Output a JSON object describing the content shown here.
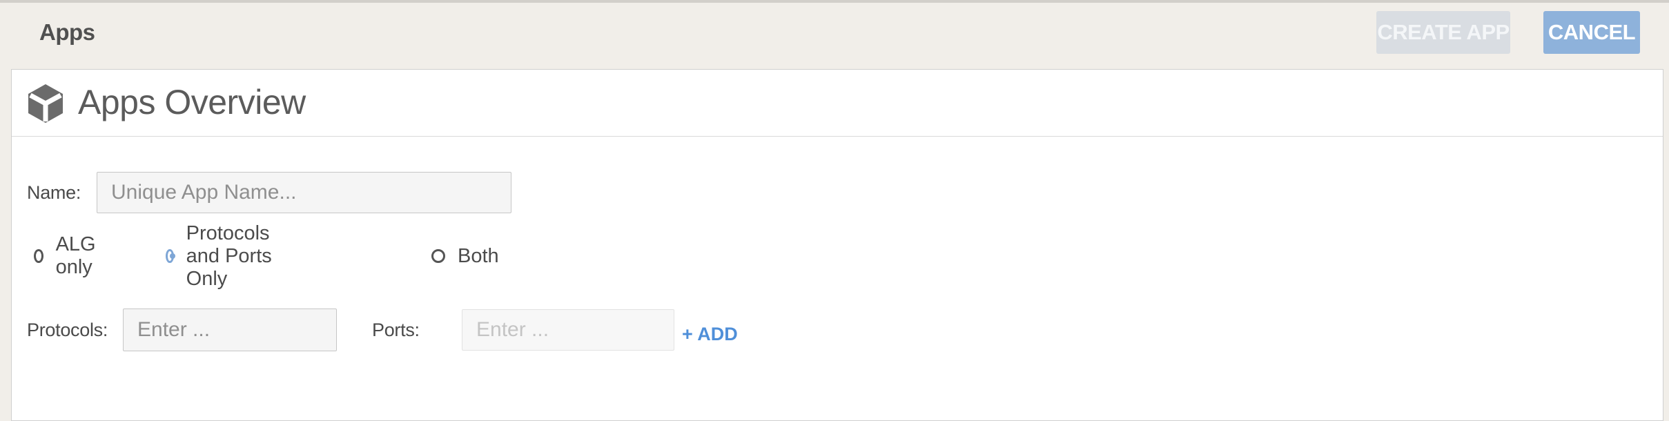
{
  "header": {
    "title": "Apps",
    "create_button": "CREATE APP",
    "cancel_button": "CANCEL"
  },
  "panel": {
    "title": "Apps Overview",
    "icon": "cube-icon"
  },
  "form": {
    "name_label": "Name:",
    "name_placeholder": "Unique App Name...",
    "mode_options": [
      {
        "label": "ALG only",
        "checked": false
      },
      {
        "label": "Protocols and Ports Only",
        "checked": true
      },
      {
        "label": "Both",
        "checked": false
      }
    ],
    "protocols_label": "Protocols:",
    "protocols_placeholder": "Enter ...",
    "ports_label": "Ports:",
    "ports_placeholder": "Enter ...",
    "add_link": "+ ADD"
  },
  "colors": {
    "accent": "#8eb2db",
    "link": "#4f8fd9",
    "background": "#f1eee9"
  }
}
